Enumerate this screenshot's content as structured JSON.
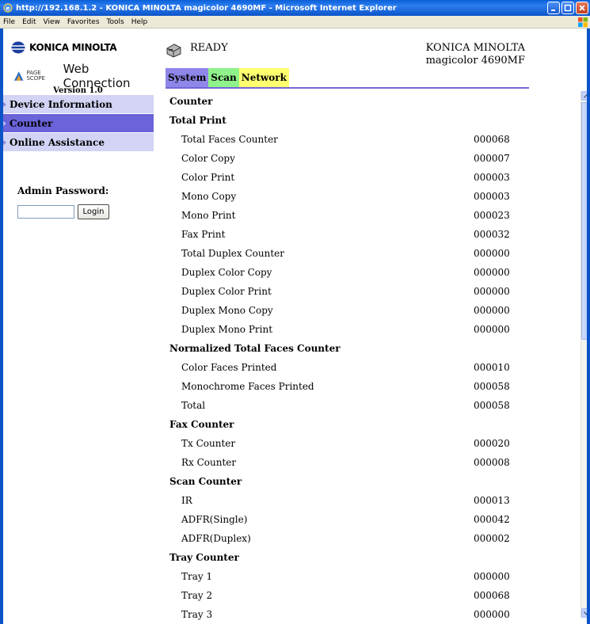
{
  "window": {
    "title": "http://192.168.1.2 - KONICA MINOLTA magicolor 4690MF - Microsoft Internet Explorer"
  },
  "menu": [
    "File",
    "Edit",
    "View",
    "Favorites",
    "Tools",
    "Help"
  ],
  "brand": {
    "company": "KONICA MINOLTA",
    "product_prefix": "PAGE SCOPE",
    "product": "Web Connection",
    "version": "Version 1.0"
  },
  "nav": {
    "items": [
      {
        "label": "Device Information"
      },
      {
        "label": "Counter"
      },
      {
        "label": "Online Assistance"
      }
    ],
    "active": "Counter"
  },
  "admin": {
    "label": "Admin Password:",
    "login_label": "Login",
    "password_value": ""
  },
  "status": {
    "text": "READY",
    "model_line1": "KONICA MINOLTA",
    "model_line2": "magicolor 4690MF"
  },
  "tabs": [
    {
      "label": "System",
      "color": "#8e86e8"
    },
    {
      "label": "Scan",
      "color": "#8ff28a"
    },
    {
      "label": "Network",
      "color": "#ffff70"
    }
  ],
  "counter": {
    "title": "Counter",
    "sections": [
      {
        "heading": "Total Print",
        "rows": [
          {
            "label": "Total Faces Counter",
            "value": "000068"
          },
          {
            "label": "Color Copy",
            "value": "000007"
          },
          {
            "label": "Color Print",
            "value": "000003"
          },
          {
            "label": "Mono Copy",
            "value": "000003"
          },
          {
            "label": "Mono Print",
            "value": "000023"
          },
          {
            "label": "Fax Print",
            "value": "000032"
          },
          {
            "label": "Total Duplex Counter",
            "value": "000000"
          },
          {
            "label": "Duplex Color Copy",
            "value": "000000"
          },
          {
            "label": "Duplex Color Print",
            "value": "000000"
          },
          {
            "label": "Duplex Mono Copy",
            "value": "000000"
          },
          {
            "label": "Duplex Mono Print",
            "value": "000000"
          }
        ]
      },
      {
        "heading": "Normalized Total Faces Counter",
        "rows": [
          {
            "label": "Color Faces Printed",
            "value": "000010"
          },
          {
            "label": "Monochrome Faces Printed",
            "value": "000058"
          },
          {
            "label": "Total",
            "value": "000058"
          }
        ]
      },
      {
        "heading": "Fax Counter",
        "rows": [
          {
            "label": "Tx Counter",
            "value": "000020"
          },
          {
            "label": "Rx Counter",
            "value": "000008"
          }
        ]
      },
      {
        "heading": "Scan Counter",
        "rows": [
          {
            "label": "IR",
            "value": "000013"
          },
          {
            "label": "ADFR(Single)",
            "value": "000042"
          },
          {
            "label": "ADFR(Duplex)",
            "value": "000002"
          }
        ]
      },
      {
        "heading": "Tray Counter",
        "rows": [
          {
            "label": "Tray 1",
            "value": "000000"
          },
          {
            "label": "Tray 2",
            "value": "000068"
          },
          {
            "label": "Tray 3",
            "value": "000000"
          }
        ]
      }
    ]
  }
}
